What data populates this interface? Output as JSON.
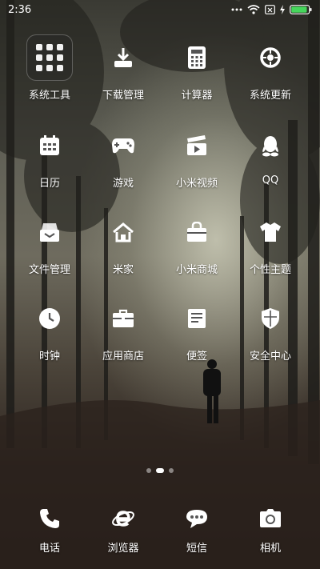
{
  "status": {
    "time": "2:36",
    "battery_level": 0.92
  },
  "apps": [
    [
      {
        "name": "app-system-tools",
        "label": "系统工具",
        "icon": "folder-icon"
      },
      {
        "name": "app-downloads",
        "label": "下载管理",
        "icon": "download-icon"
      },
      {
        "name": "app-calculator",
        "label": "计算器",
        "icon": "calculator-icon"
      },
      {
        "name": "app-system-update",
        "label": "系统更新",
        "icon": "update-icon"
      }
    ],
    [
      {
        "name": "app-calendar",
        "label": "日历",
        "icon": "calendar-icon"
      },
      {
        "name": "app-games",
        "label": "游戏",
        "icon": "gamepad-icon"
      },
      {
        "name": "app-mi-video",
        "label": "小米视频",
        "icon": "video-icon"
      },
      {
        "name": "app-qq",
        "label": "QQ",
        "icon": "qq-icon"
      }
    ],
    [
      {
        "name": "app-file-manager",
        "label": "文件管理",
        "icon": "file-manager-icon"
      },
      {
        "name": "app-mi-home",
        "label": "米家",
        "icon": "home-icon"
      },
      {
        "name": "app-mi-store",
        "label": "小米商城",
        "icon": "store-bag-icon"
      },
      {
        "name": "app-themes",
        "label": "个性主题",
        "icon": "tshirt-icon"
      }
    ],
    [
      {
        "name": "app-clock",
        "label": "时钟",
        "icon": "clock-icon"
      },
      {
        "name": "app-app-store",
        "label": "应用商店",
        "icon": "briefcase-icon"
      },
      {
        "name": "app-notes",
        "label": "便签",
        "icon": "note-icon"
      },
      {
        "name": "app-security",
        "label": "安全中心",
        "icon": "shield-icon"
      }
    ]
  ],
  "dock": [
    {
      "name": "dock-phone",
      "label": "电话",
      "icon": "phone-icon"
    },
    {
      "name": "dock-browser",
      "label": "浏览器",
      "icon": "browser-icon"
    },
    {
      "name": "dock-messages",
      "label": "短信",
      "icon": "message-icon"
    },
    {
      "name": "dock-camera",
      "label": "相机",
      "icon": "camera-icon"
    }
  ],
  "pages": {
    "count": 3,
    "current": 2
  }
}
